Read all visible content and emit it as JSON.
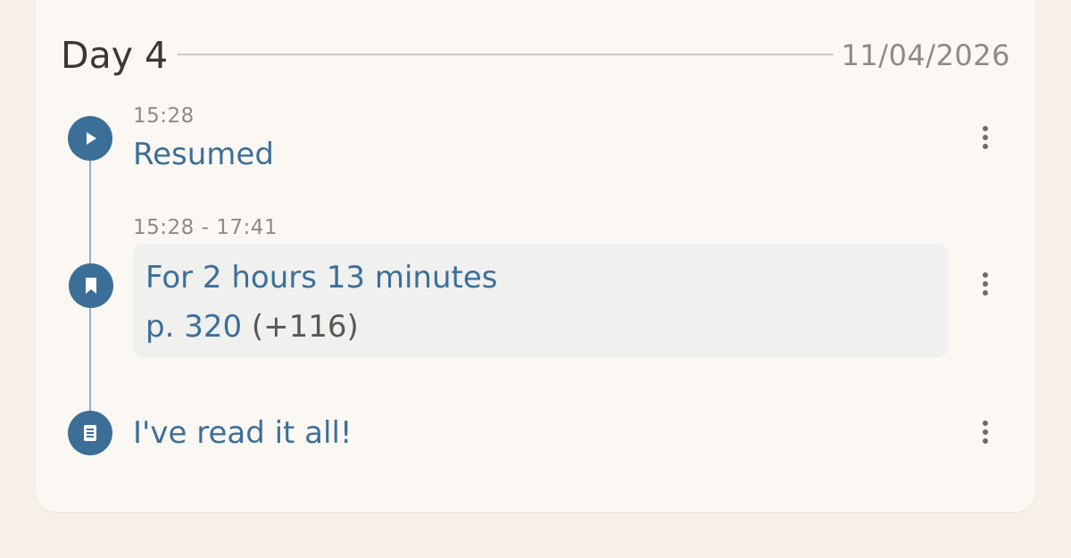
{
  "day": {
    "title": "Day 4",
    "date": "11/04/2026"
  },
  "events": [
    {
      "icon": "play-icon",
      "time": "15:28",
      "label": "Resumed"
    },
    {
      "icon": "bookmark-icon",
      "time": "15:28 - 17:41",
      "duration": "For 2 hours 13 minutes",
      "page": "p. 320",
      "page_delta": "(+116)"
    },
    {
      "icon": "book-icon",
      "label": "I've read it all!"
    }
  ],
  "colors": {
    "accent": "#3c6f98",
    "text_accent": "#3d6f98",
    "background": "#f7f0e6",
    "card": "#fbf8f4",
    "session_box": "#f0f0ef"
  }
}
